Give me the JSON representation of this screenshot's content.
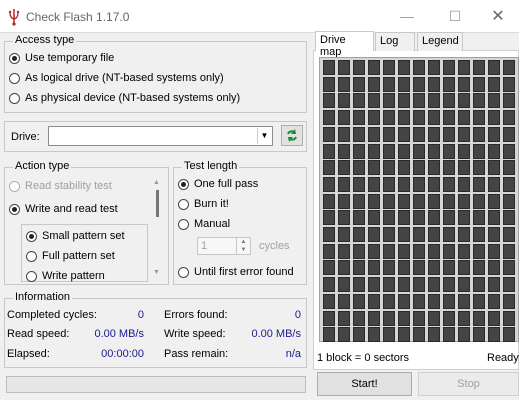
{
  "window": {
    "title": "Check Flash 1.17.0",
    "controls": {
      "minimize": "—",
      "maximize": "☐",
      "close": "✕"
    },
    "app_icon": "usb-icon"
  },
  "access_type": {
    "title": "Access type",
    "options": [
      {
        "label": "Use temporary file",
        "checked": true
      },
      {
        "label": "As logical drive (NT-based systems only)",
        "checked": false
      },
      {
        "label": "As physical device (NT-based systems only)",
        "checked": false
      }
    ]
  },
  "drive": {
    "label": "Drive:",
    "value": "",
    "refresh_icon": "refresh-icon"
  },
  "action_type": {
    "title": "Action type",
    "options": [
      {
        "label": "Read stability test",
        "checked": false,
        "disabled": true
      },
      {
        "label": "Write and read test",
        "checked": true,
        "disabled": false
      }
    ],
    "sub_options": [
      {
        "label": "Small pattern set",
        "checked": true
      },
      {
        "label": "Full pattern set",
        "checked": false
      },
      {
        "label": "Write pattern",
        "checked": false
      }
    ]
  },
  "test_length": {
    "title": "Test length",
    "options": [
      {
        "label": "One full pass",
        "checked": true
      },
      {
        "label": "Burn it!",
        "checked": false
      },
      {
        "label": "Manual",
        "checked": false
      }
    ],
    "spin_value": "1",
    "spin_unit": "cycles",
    "last_option": {
      "label": "Until first error found",
      "checked": false
    }
  },
  "information": {
    "title": "Information",
    "rows": [
      {
        "left_label": "Completed cycles:",
        "left_value": "0",
        "right_label": "Errors found:",
        "right_value": "0"
      },
      {
        "left_label": "Read speed:",
        "left_value": "0.00 MB/s",
        "right_label": "Write speed:",
        "right_value": "0.00 MB/s"
      },
      {
        "left_label": "Elapsed:",
        "left_value": "00:00:00",
        "right_label": "Pass remain:",
        "right_value": "n/a"
      }
    ]
  },
  "tabs": [
    {
      "label": "Drive map",
      "active": true
    },
    {
      "label": "Log",
      "active": false
    },
    {
      "label": "Legend",
      "active": false
    }
  ],
  "drive_map": {
    "block_info": "1 block = 0 sectors",
    "status": "Ready",
    "columns": 13,
    "rows": 17
  },
  "buttons": {
    "start": "Start!",
    "stop": "Stop"
  },
  "progress": {
    "value": 0
  }
}
